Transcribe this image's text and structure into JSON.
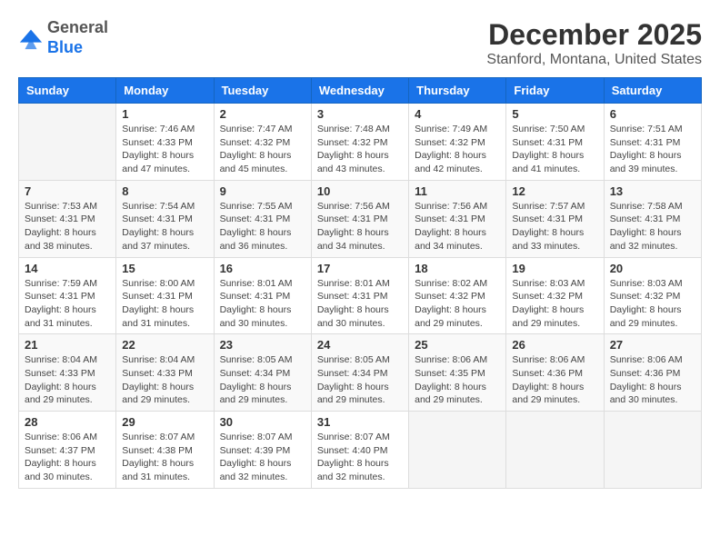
{
  "header": {
    "logo": {
      "general": "General",
      "blue": "Blue"
    },
    "title": "December 2025",
    "location": "Stanford, Montana, United States"
  },
  "weekdays": [
    "Sunday",
    "Monday",
    "Tuesday",
    "Wednesday",
    "Thursday",
    "Friday",
    "Saturday"
  ],
  "weeks": [
    [
      {
        "day": "",
        "sunrise": "",
        "sunset": "",
        "daylight": ""
      },
      {
        "day": "1",
        "sunrise": "Sunrise: 7:46 AM",
        "sunset": "Sunset: 4:33 PM",
        "daylight": "Daylight: 8 hours and 47 minutes."
      },
      {
        "day": "2",
        "sunrise": "Sunrise: 7:47 AM",
        "sunset": "Sunset: 4:32 PM",
        "daylight": "Daylight: 8 hours and 45 minutes."
      },
      {
        "day": "3",
        "sunrise": "Sunrise: 7:48 AM",
        "sunset": "Sunset: 4:32 PM",
        "daylight": "Daylight: 8 hours and 43 minutes."
      },
      {
        "day": "4",
        "sunrise": "Sunrise: 7:49 AM",
        "sunset": "Sunset: 4:32 PM",
        "daylight": "Daylight: 8 hours and 42 minutes."
      },
      {
        "day": "5",
        "sunrise": "Sunrise: 7:50 AM",
        "sunset": "Sunset: 4:31 PM",
        "daylight": "Daylight: 8 hours and 41 minutes."
      },
      {
        "day": "6",
        "sunrise": "Sunrise: 7:51 AM",
        "sunset": "Sunset: 4:31 PM",
        "daylight": "Daylight: 8 hours and 39 minutes."
      }
    ],
    [
      {
        "day": "7",
        "sunrise": "Sunrise: 7:53 AM",
        "sunset": "Sunset: 4:31 PM",
        "daylight": "Daylight: 8 hours and 38 minutes."
      },
      {
        "day": "8",
        "sunrise": "Sunrise: 7:54 AM",
        "sunset": "Sunset: 4:31 PM",
        "daylight": "Daylight: 8 hours and 37 minutes."
      },
      {
        "day": "9",
        "sunrise": "Sunrise: 7:55 AM",
        "sunset": "Sunset: 4:31 PM",
        "daylight": "Daylight: 8 hours and 36 minutes."
      },
      {
        "day": "10",
        "sunrise": "Sunrise: 7:56 AM",
        "sunset": "Sunset: 4:31 PM",
        "daylight": "Daylight: 8 hours and 34 minutes."
      },
      {
        "day": "11",
        "sunrise": "Sunrise: 7:56 AM",
        "sunset": "Sunset: 4:31 PM",
        "daylight": "Daylight: 8 hours and 34 minutes."
      },
      {
        "day": "12",
        "sunrise": "Sunrise: 7:57 AM",
        "sunset": "Sunset: 4:31 PM",
        "daylight": "Daylight: 8 hours and 33 minutes."
      },
      {
        "day": "13",
        "sunrise": "Sunrise: 7:58 AM",
        "sunset": "Sunset: 4:31 PM",
        "daylight": "Daylight: 8 hours and 32 minutes."
      }
    ],
    [
      {
        "day": "14",
        "sunrise": "Sunrise: 7:59 AM",
        "sunset": "Sunset: 4:31 PM",
        "daylight": "Daylight: 8 hours and 31 minutes."
      },
      {
        "day": "15",
        "sunrise": "Sunrise: 8:00 AM",
        "sunset": "Sunset: 4:31 PM",
        "daylight": "Daylight: 8 hours and 31 minutes."
      },
      {
        "day": "16",
        "sunrise": "Sunrise: 8:01 AM",
        "sunset": "Sunset: 4:31 PM",
        "daylight": "Daylight: 8 hours and 30 minutes."
      },
      {
        "day": "17",
        "sunrise": "Sunrise: 8:01 AM",
        "sunset": "Sunset: 4:31 PM",
        "daylight": "Daylight: 8 hours and 30 minutes."
      },
      {
        "day": "18",
        "sunrise": "Sunrise: 8:02 AM",
        "sunset": "Sunset: 4:32 PM",
        "daylight": "Daylight: 8 hours and 29 minutes."
      },
      {
        "day": "19",
        "sunrise": "Sunrise: 8:03 AM",
        "sunset": "Sunset: 4:32 PM",
        "daylight": "Daylight: 8 hours and 29 minutes."
      },
      {
        "day": "20",
        "sunrise": "Sunrise: 8:03 AM",
        "sunset": "Sunset: 4:32 PM",
        "daylight": "Daylight: 8 hours and 29 minutes."
      }
    ],
    [
      {
        "day": "21",
        "sunrise": "Sunrise: 8:04 AM",
        "sunset": "Sunset: 4:33 PM",
        "daylight": "Daylight: 8 hours and 29 minutes."
      },
      {
        "day": "22",
        "sunrise": "Sunrise: 8:04 AM",
        "sunset": "Sunset: 4:33 PM",
        "daylight": "Daylight: 8 hours and 29 minutes."
      },
      {
        "day": "23",
        "sunrise": "Sunrise: 8:05 AM",
        "sunset": "Sunset: 4:34 PM",
        "daylight": "Daylight: 8 hours and 29 minutes."
      },
      {
        "day": "24",
        "sunrise": "Sunrise: 8:05 AM",
        "sunset": "Sunset: 4:34 PM",
        "daylight": "Daylight: 8 hours and 29 minutes."
      },
      {
        "day": "25",
        "sunrise": "Sunrise: 8:06 AM",
        "sunset": "Sunset: 4:35 PM",
        "daylight": "Daylight: 8 hours and 29 minutes."
      },
      {
        "day": "26",
        "sunrise": "Sunrise: 8:06 AM",
        "sunset": "Sunset: 4:36 PM",
        "daylight": "Daylight: 8 hours and 29 minutes."
      },
      {
        "day": "27",
        "sunrise": "Sunrise: 8:06 AM",
        "sunset": "Sunset: 4:36 PM",
        "daylight": "Daylight: 8 hours and 30 minutes."
      }
    ],
    [
      {
        "day": "28",
        "sunrise": "Sunrise: 8:06 AM",
        "sunset": "Sunset: 4:37 PM",
        "daylight": "Daylight: 8 hours and 30 minutes."
      },
      {
        "day": "29",
        "sunrise": "Sunrise: 8:07 AM",
        "sunset": "Sunset: 4:38 PM",
        "daylight": "Daylight: 8 hours and 31 minutes."
      },
      {
        "day": "30",
        "sunrise": "Sunrise: 8:07 AM",
        "sunset": "Sunset: 4:39 PM",
        "daylight": "Daylight: 8 hours and 32 minutes."
      },
      {
        "day": "31",
        "sunrise": "Sunrise: 8:07 AM",
        "sunset": "Sunset: 4:40 PM",
        "daylight": "Daylight: 8 hours and 32 minutes."
      },
      {
        "day": "",
        "sunrise": "",
        "sunset": "",
        "daylight": ""
      },
      {
        "day": "",
        "sunrise": "",
        "sunset": "",
        "daylight": ""
      },
      {
        "day": "",
        "sunrise": "",
        "sunset": "",
        "daylight": ""
      }
    ]
  ]
}
